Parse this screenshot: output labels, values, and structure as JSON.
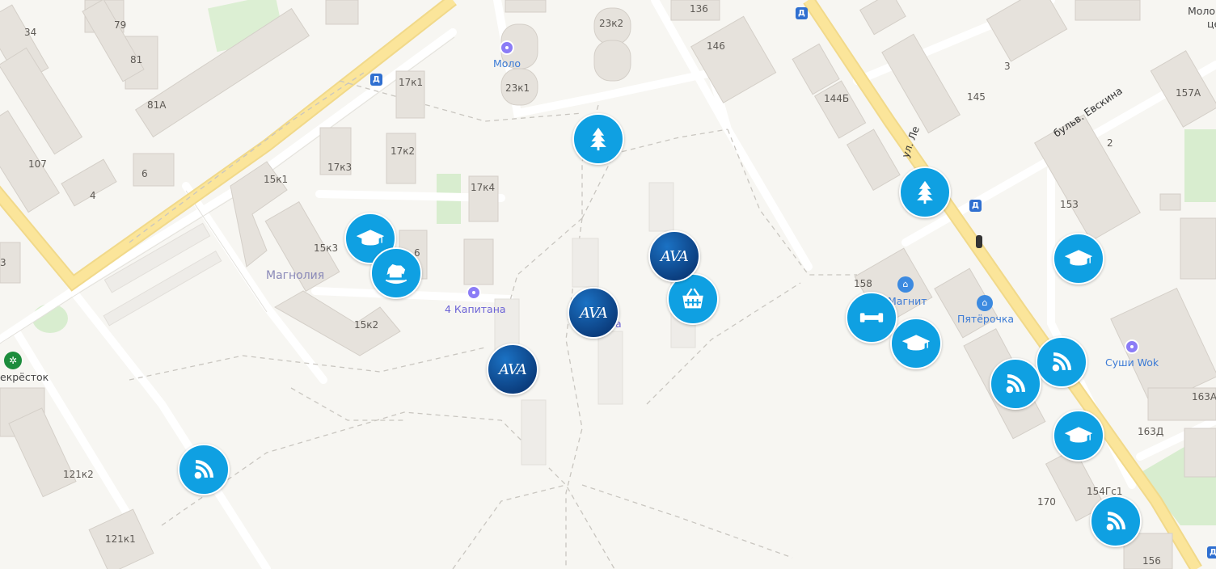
{
  "map": {
    "district_label": "Магнолия",
    "street_labels": {
      "lenina": "ул. Ле",
      "evskina": "бульв. Евскина"
    },
    "house_numbers": {
      "h34": "34",
      "h79": "79",
      "h81": "81",
      "h81a": "81А",
      "h107": "107",
      "h6": "6",
      "h4": "4",
      "h3": "3",
      "h17k1": "17к1",
      "h17k2": "17к2",
      "h17k3": "17к3",
      "h17k4": "17к4",
      "h15k1": "15к1",
      "h15k3": "15к3",
      "h15k2": "15к2",
      "h6b": "6",
      "h23k1": "23к1",
      "h23k2": "23к2",
      "h136": "136",
      "h146": "146",
      "h144b": "144Б",
      "h145": "145",
      "h3r": "3",
      "h157a": "157А",
      "h2": "2",
      "h153": "153",
      "h158": "158",
      "h163a": "163А",
      "h163d": "163Д",
      "h154g": "154Гс1",
      "h170": "170",
      "h156": "156",
      "h121k2": "121к2",
      "h121k1": "121к1"
    },
    "pois": {
      "kapitana": "4 Капитана",
      "molo": "Моло",
      "magnit": "Магнит",
      "pyaterochka": "Пятёрочка",
      "sushi": "Суши Wok",
      "perekrestok": "екрёсток",
      "molo_right": "Моло",
      "molo_right2": "це",
      "ava_partial": "а"
    },
    "markers": {
      "ava_text": "AVA",
      "icons": {
        "tree": "tree-icon",
        "school": "graduation-cap-icon",
        "horse": "rocking-horse-icon",
        "basket": "shopping-basket-icon",
        "gym": "dumbbell-icon",
        "wifi": "signal-icon"
      }
    },
    "colors": {
      "marker": "#0fa0e2",
      "ava_marker": "#0b3c7c",
      "main_road": "#fbe59a",
      "building": "#e6e2dc",
      "background": "#f7f6f2"
    }
  }
}
